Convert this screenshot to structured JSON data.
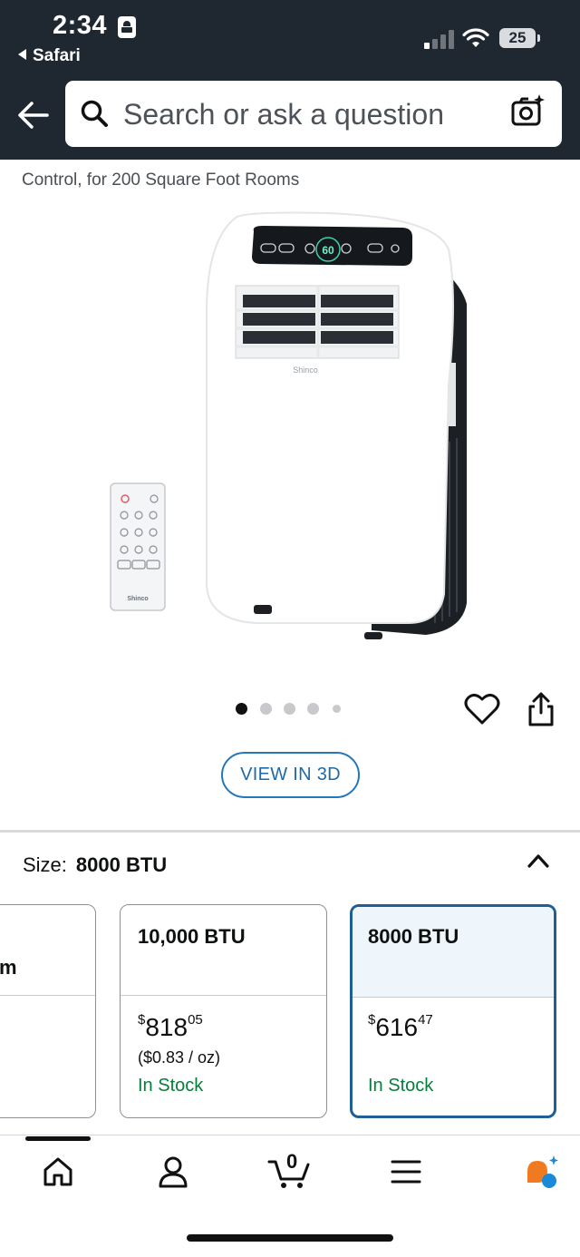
{
  "status_bar": {
    "time": "2:34",
    "back_app": "Safari",
    "battery": "25"
  },
  "search": {
    "placeholder": "Search or ask a question"
  },
  "product": {
    "title_fragment": "Control, for 200 Square Foot Rooms",
    "brand_on_unit": "Shinco",
    "display_temp": "60",
    "image_count": 5,
    "active_image": 1
  },
  "view_3d": {
    "label": "VIEW IN 3D"
  },
  "size": {
    "label": "Size:",
    "selected": "8000 BTU"
  },
  "size_options": [
    {
      "name": "m",
      "selected": false
    },
    {
      "name": "10,000 BTU",
      "price_symbol": "$",
      "price_whole": "818",
      "price_fraction": "05",
      "unit_price": "($0.83 / oz)",
      "stock": "In Stock",
      "selected": false
    },
    {
      "name": "8000 BTU",
      "price_symbol": "$",
      "price_whole": "616",
      "price_fraction": "47",
      "stock": "In Stock",
      "selected": true
    }
  ],
  "tabbar": {
    "cart_count": "0",
    "items": [
      "home-icon",
      "account-icon",
      "cart-icon",
      "menu-icon",
      "rufus-icon"
    ]
  },
  "colors": {
    "header_bg": "#1f2731",
    "link_blue": "#1f6aa6",
    "stock_green": "#067d3b",
    "selected_border": "#1f5f95",
    "selected_bg": "#eef6fc"
  }
}
